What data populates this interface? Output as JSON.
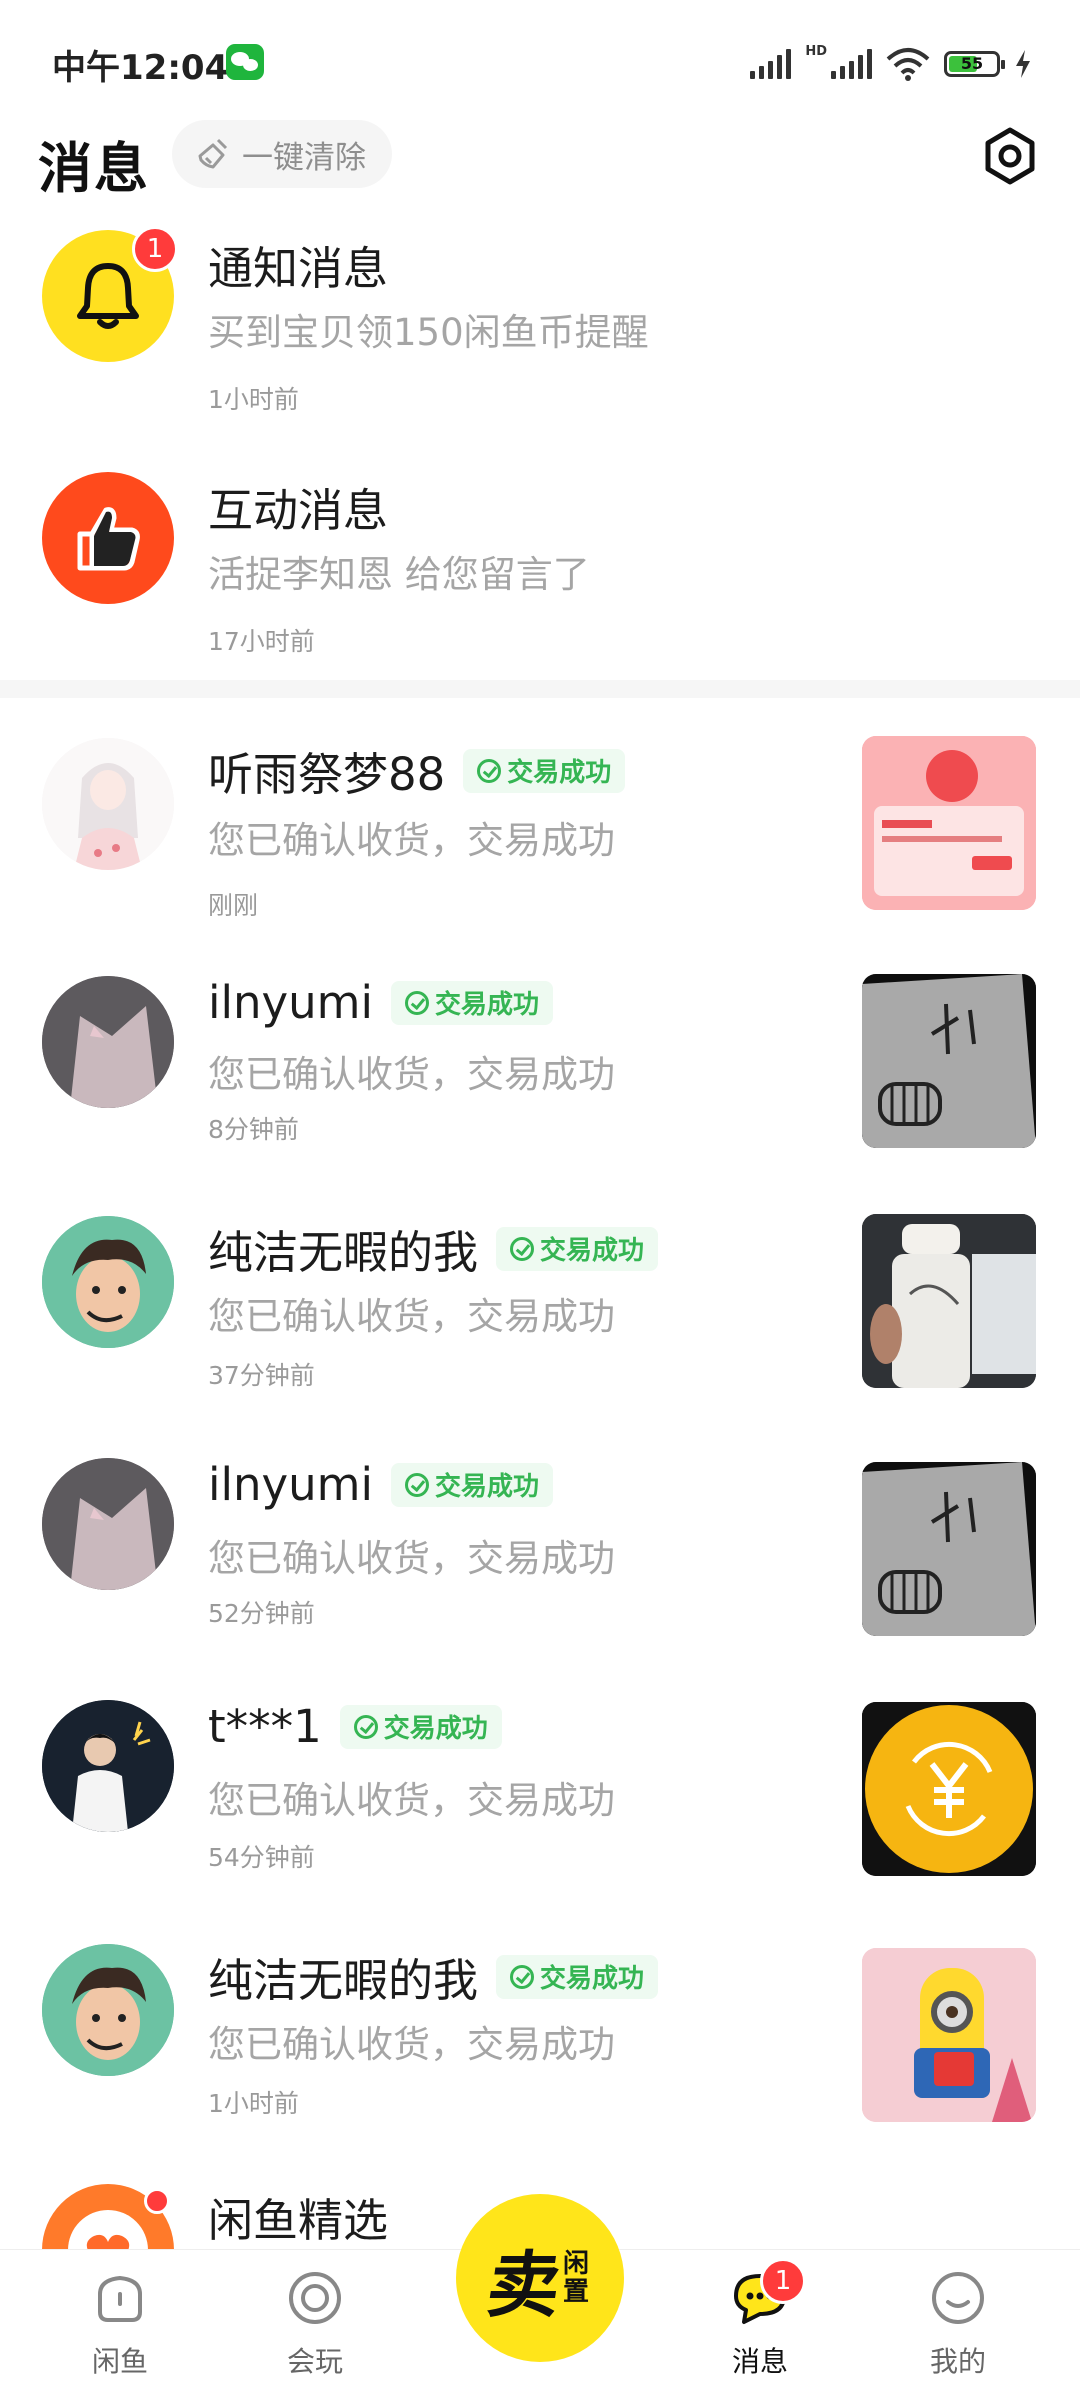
{
  "status_bar": {
    "time": "中午12:04",
    "battery": "55",
    "hd": "HD"
  },
  "header": {
    "title": "消息",
    "clear_label": "一键清除"
  },
  "system_items": [
    {
      "title": "通知消息",
      "subtitle": "买到宝贝领150闲鱼币提醒",
      "time": "1小时前",
      "badge": "1",
      "color": "#ffe020"
    },
    {
      "title": "互动消息",
      "subtitle": "活捉李知恩 给您留言了",
      "time": "17小时前",
      "color": "#ff4a1c"
    }
  ],
  "conversations": [
    {
      "name": "听雨祭梦88",
      "tag": "交易成功",
      "message": "您已确认收货，交易成功",
      "time": "刚刚",
      "avatar": "anime-girl-avatar",
      "thumb": "red-coupon-thumb"
    },
    {
      "name": "ilnyumi",
      "tag": "交易成功",
      "message": "您已确认收货，交易成功",
      "time": "8分钟前",
      "avatar": "cat-ear-avatar",
      "thumb": "sketch-board-thumb"
    },
    {
      "name": "纯洁无暇的我",
      "tag": "交易成功",
      "message": "您已确认收货，交易成功",
      "time": "37分钟前",
      "avatar": "cartoon-man-avatar",
      "thumb": "tumbler-thumb"
    },
    {
      "name": "ilnyumi",
      "tag": "交易成功",
      "message": "您已确认收货，交易成功",
      "time": "52分钟前",
      "avatar": "cat-ear-avatar",
      "thumb": "sketch-board-thumb"
    },
    {
      "name": "t***1",
      "tag": "交易成功",
      "message": "您已确认收货，交易成功",
      "time": "54分钟前",
      "avatar": "boy-sparkler-avatar",
      "thumb": "yuan-coin-thumb"
    },
    {
      "name": "纯洁无暇的我",
      "tag": "交易成功",
      "message": "您已确认收货，交易成功",
      "time": "1小时前",
      "avatar": "cartoon-man-avatar",
      "thumb": "minion-card-thumb"
    }
  ],
  "partial_item": {
    "title": "闲鱼精选"
  },
  "bottom_nav": {
    "items": [
      "闲鱼",
      "会玩",
      "消息",
      "我的"
    ],
    "sell_big": "卖",
    "sell_small": "闲置",
    "messages_badge": "1"
  },
  "colors": {
    "accent_yellow": "#ffe51a",
    "success_green": "#35b553",
    "badge_red": "#ff3b3b"
  }
}
